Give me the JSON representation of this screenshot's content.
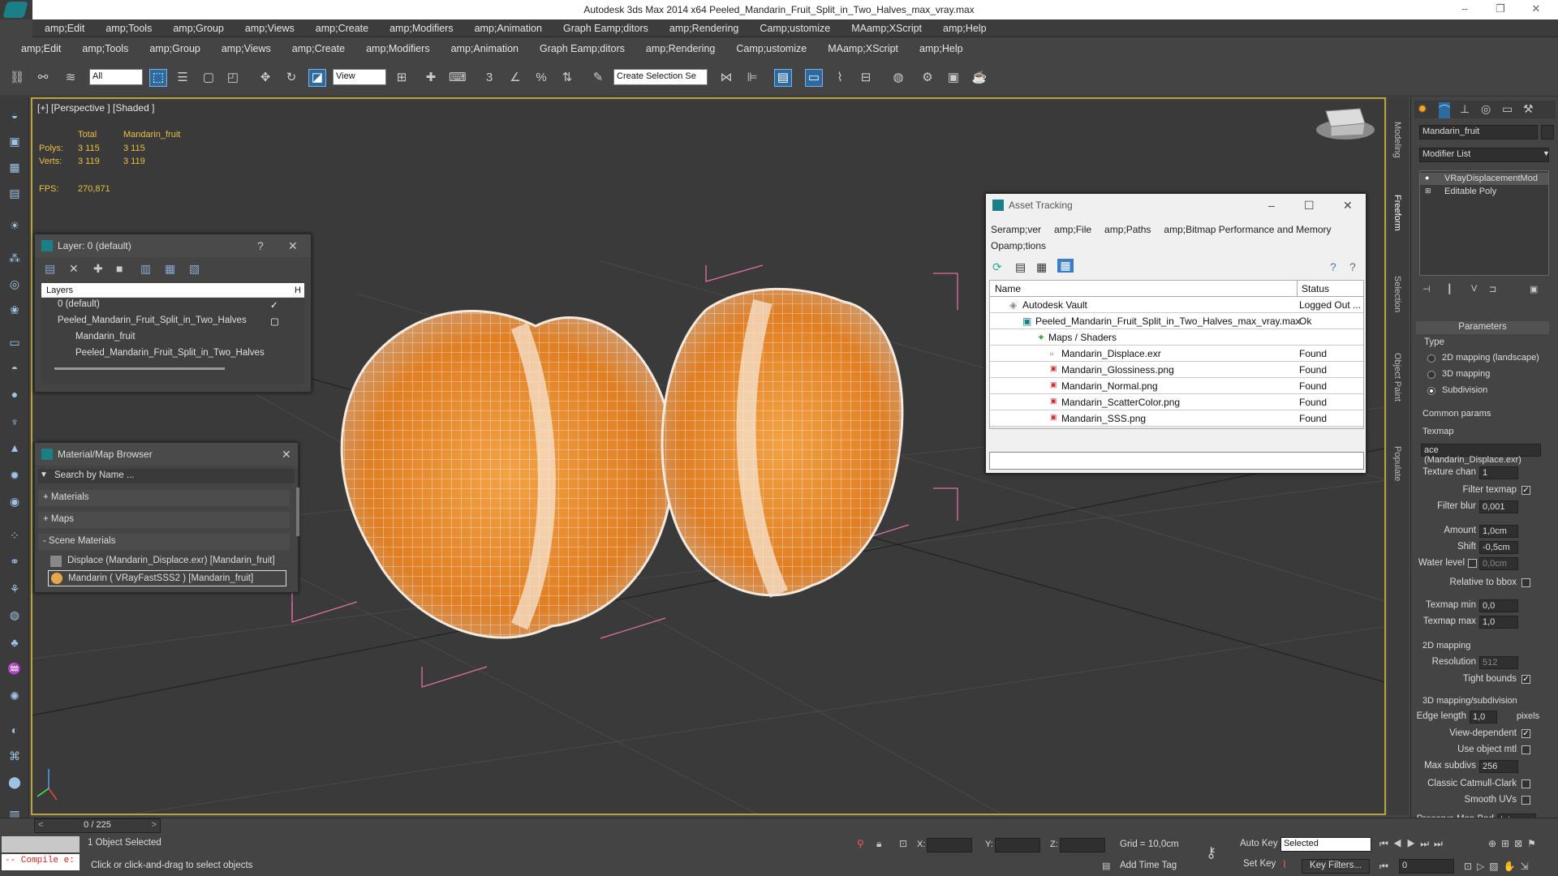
{
  "window": {
    "title": "Autodesk 3ds Max  2014 x64      Peeled_Mandarin_Fruit_Split_in_Two_Halves_max_vray.max"
  },
  "menu_top": [
    "amp;Edit",
    "amp;Tools",
    "amp;Group",
    "amp;Views",
    "amp;Create",
    "amp;Modifiers",
    "amp;Animation",
    "Graph Eamp;ditors",
    "amp;Rendering",
    "Camp;ustomize",
    "MAamp;XScript",
    "amp;Help"
  ],
  "menu_main": [
    "amp;Edit",
    "amp;Tools",
    "amp;Group",
    "amp;Views",
    "amp;Create",
    "amp;Modifiers",
    "amp;Animation",
    "Graph Eamp;ditors",
    "amp;Rendering",
    "Camp;ustomize",
    "MAamp;XScript",
    "amp;Help"
  ],
  "toolbar": {
    "filter_value": "All",
    "refcoord_value": "View",
    "selection_set_placeholder": "Create Selection Se"
  },
  "viewport": {
    "label": "[+] [Perspective ] [Shaded ]",
    "stats": {
      "col_total": "Total",
      "col_obj": "Mandarin_fruit",
      "polys_label": "Polys:",
      "polys_total": "3 115",
      "polys_obj": "3 115",
      "verts_label": "Verts:",
      "verts_total": "3 119",
      "verts_obj": "3 119",
      "fps_label": "FPS:",
      "fps_value": "270,871"
    }
  },
  "side_tabs": [
    "Modeling",
    "Freeform",
    "Selection",
    "Object Paint",
    "Populate"
  ],
  "layer_window": {
    "title": "Layer: 0 (default)",
    "help": "?",
    "col_layers": "Layers",
    "col_h": "H",
    "rows": [
      "0 (default)",
      "Peeled_Mandarin_Fruit_Split_in_Two_Halves",
      "Mandarin_fruit",
      "Peeled_Mandarin_Fruit_Split_in_Two_Halves"
    ]
  },
  "material_browser": {
    "title": "Material/Map Browser",
    "search_placeholder": "Search by Name ...",
    "groups": [
      "+ Materials",
      "+ Maps",
      "- Scene Materials"
    ],
    "items": [
      "Displace (Mandarin_Displace.exr) [Mandarin_fruit]",
      "Mandarin  ( VRayFastSSS2 ) [Mandarin_fruit]"
    ]
  },
  "asset_tracking": {
    "title": "Asset Tracking",
    "menu": [
      "Seramp;ver",
      "amp;File",
      "amp;Paths",
      "amp;Bitmap Performance and Memory",
      "Opamp;tions"
    ],
    "col_name": "Name",
    "col_status": "Status",
    "rows": [
      {
        "name": "Autodesk Vault",
        "status": "Logged Out ..."
      },
      {
        "name": "Peeled_Mandarin_Fruit_Split_in_Two_Halves_max_vray.max",
        "status": "Ok"
      },
      {
        "name": "Maps / Shaders",
        "status": ""
      },
      {
        "name": "Mandarin_Displace.exr",
        "status": "Found"
      },
      {
        "name": "Mandarin_Glossiness.png",
        "status": "Found"
      },
      {
        "name": "Mandarin_Normal.png",
        "status": "Found"
      },
      {
        "name": "Mandarin_ScatterColor.png",
        "status": "Found"
      },
      {
        "name": "Mandarin_SSS.png",
        "status": "Found"
      }
    ]
  },
  "right_panel": {
    "object_name": "Mandarin_fruit",
    "modifier_list": "Modifier List",
    "stack": [
      "VRayDisplacementMod",
      "Editable Poly"
    ],
    "parameters": "Parameters",
    "type_label": "Type",
    "type_options": [
      "2D mapping (landscape)",
      "3D mapping",
      "Subdivision"
    ],
    "common_params": "Common params",
    "texmap_label": "Texmap",
    "texmap_value": "ace (Mandarin_Displace.exr)",
    "texture_chan_label": "Texture chan",
    "texture_chan_value": "1",
    "filter_texmap_label": "Filter texmap",
    "filter_blur_label": "Filter blur",
    "filter_blur_value": "0,001",
    "amount_label": "Amount",
    "amount_value": "1,0cm",
    "shift_label": "Shift",
    "shift_value": "-0,5cm",
    "water_level_label": "Water level",
    "water_level_value": "0,0cm",
    "relative_bbox_label": "Relative to bbox",
    "texmap_min_label": "Texmap min",
    "texmap_min_value": "0,0",
    "texmap_max_label": "Texmap max",
    "texmap_max_value": "1,0",
    "mapping2d_label": "2D mapping",
    "resolution_label": "Resolution",
    "resolution_value": "512",
    "tight_bounds_label": "Tight bounds",
    "mapping3d_label": "3D mapping/subdivision",
    "edge_length_label": "Edge length",
    "edge_length_value": "1,0",
    "pixels_label": "pixels",
    "view_dependent_label": "View-dependent",
    "use_object_mtl_label": "Use object mtl",
    "max_subdivs_label": "Max subdivs",
    "max_subdivs_value": "256",
    "catmull_label": "Classic Catmull-Clark",
    "smooth_uvs_label": "Smooth UVs",
    "preserve_label": "Preserve Map Bnd",
    "preserve_value": "Interr"
  },
  "statusbar": {
    "frame_counter": "0 / 225",
    "maxscript": "-- Compile e:",
    "selected_text": "1 Object Selected",
    "prompt": "Click or click-and-drag to select objects",
    "x_label": "X:",
    "y_label": "Y:",
    "z_label": "Z:",
    "grid": "Grid = 10,0cm",
    "add_time_tag": "Add Time Tag",
    "auto_key": "Auto Key",
    "set_key": "Set Key",
    "key_mode": "Selected",
    "key_filters": "Key Filters...",
    "time_value": "0"
  },
  "colors": {
    "viewport_border": "#b8a33c",
    "stats_text": "#e8c040",
    "fruit": "#e88a2a",
    "bbox": "#e070a0"
  }
}
